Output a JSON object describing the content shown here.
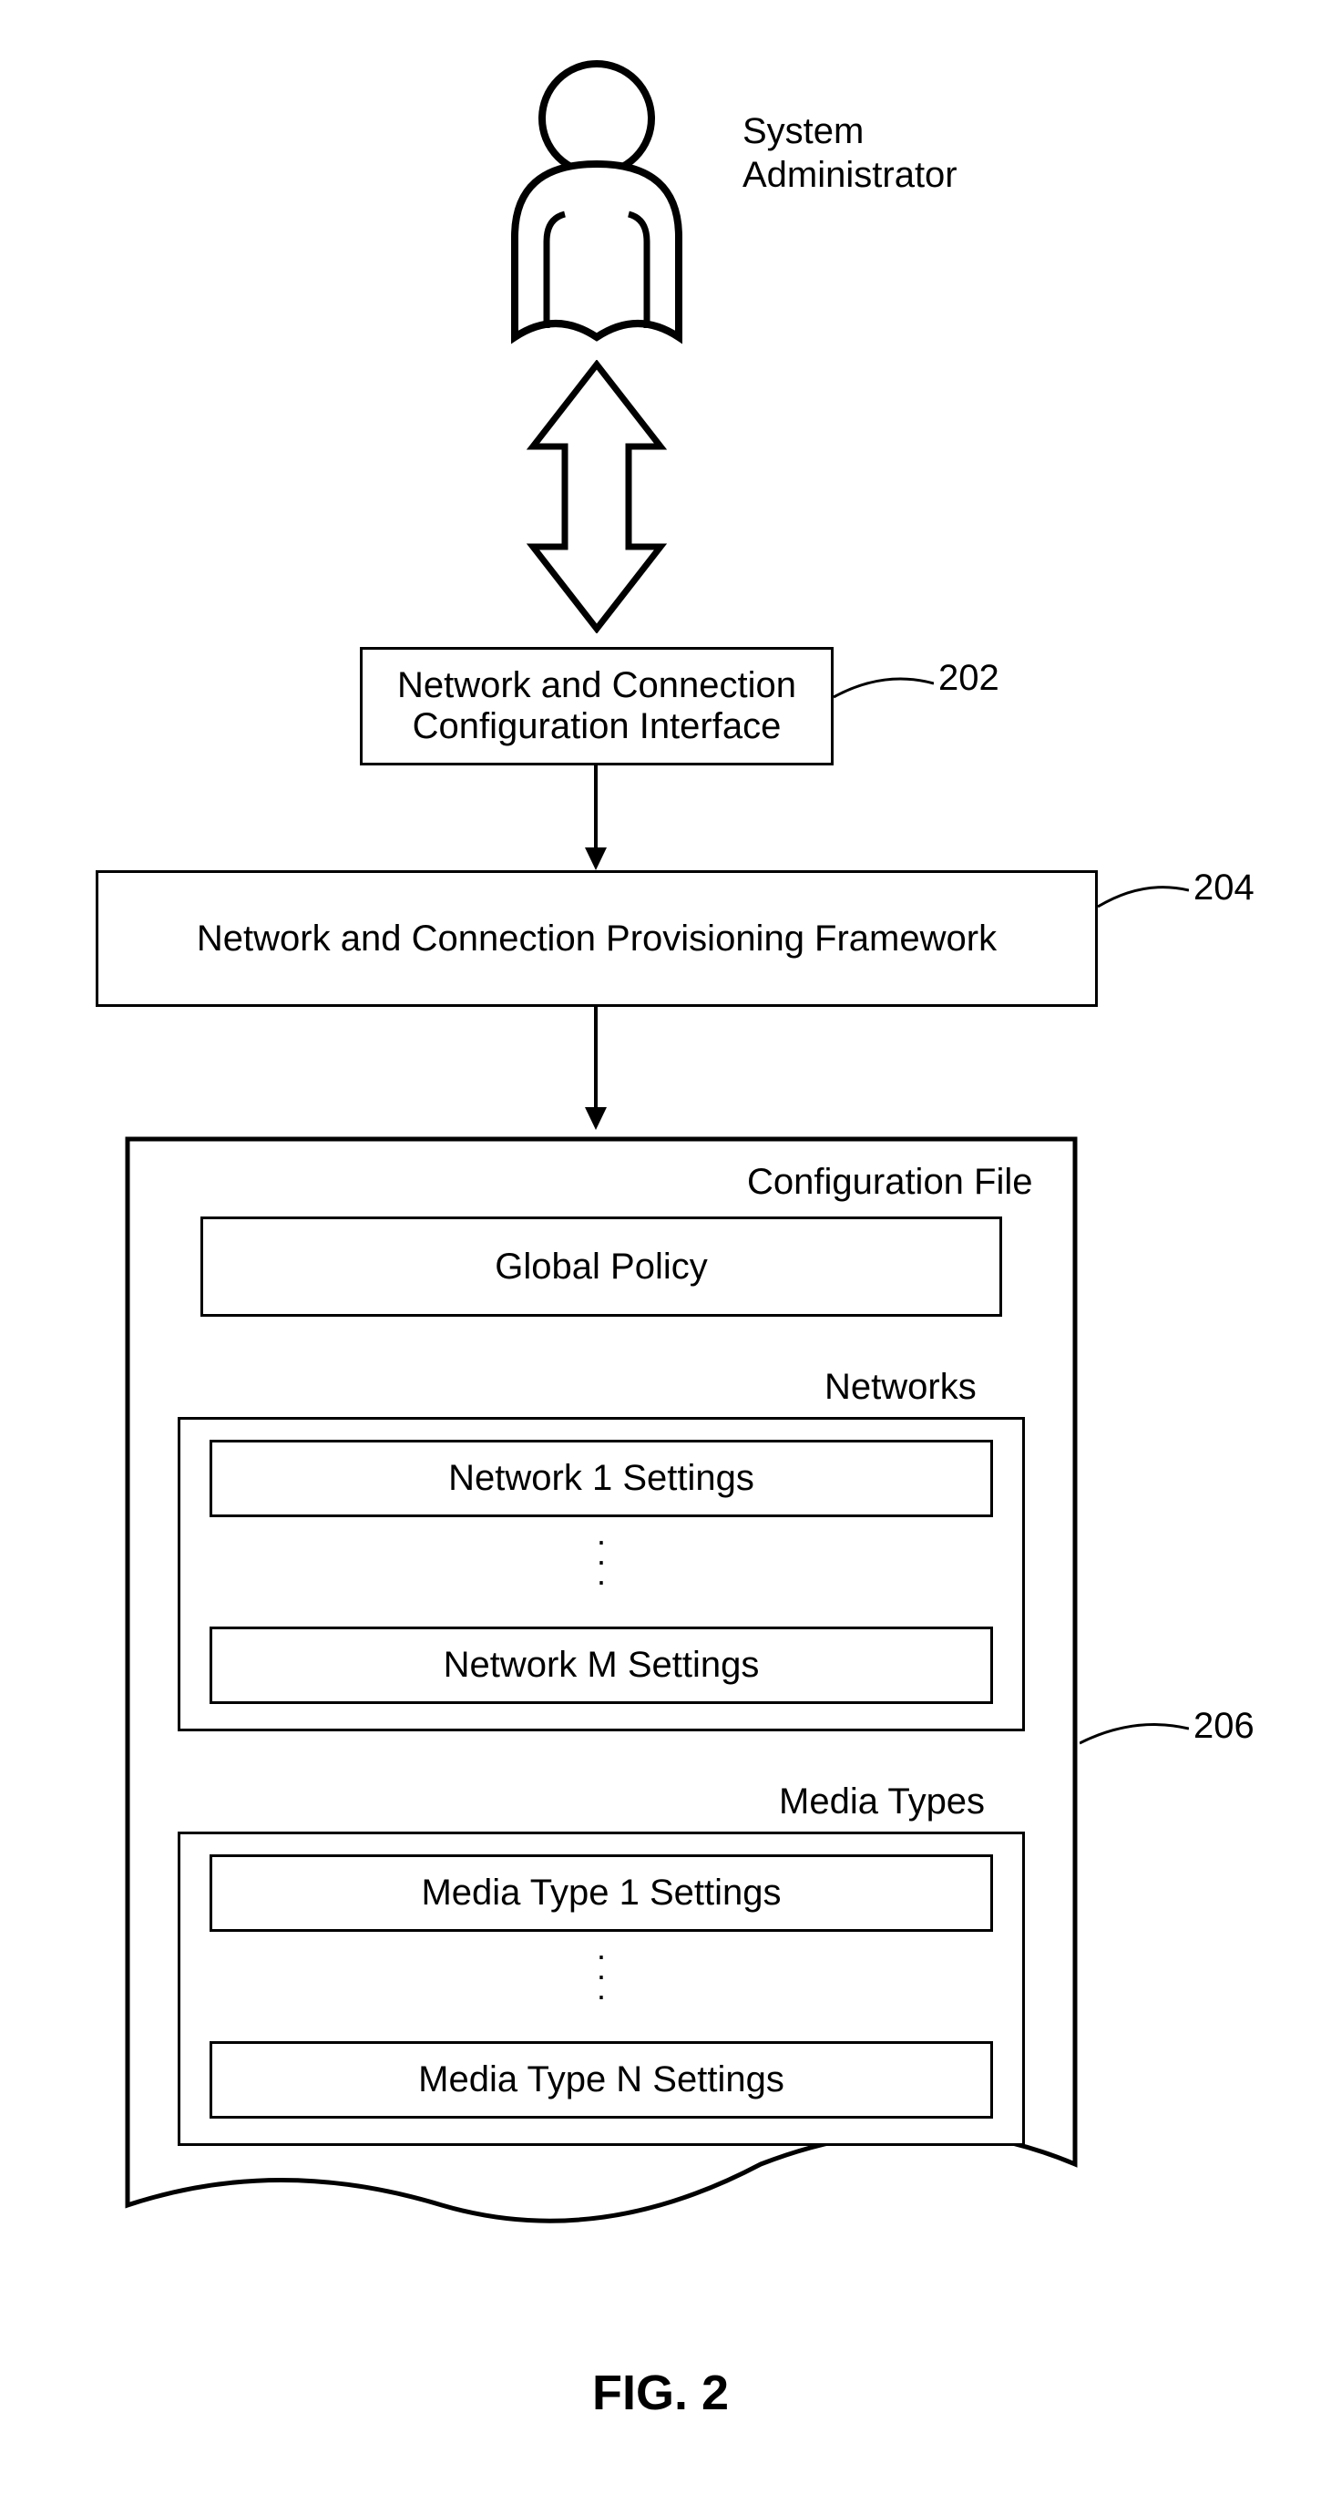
{
  "actor": {
    "label": "System\nAdministrator"
  },
  "refs": {
    "interface": "202",
    "framework": "204",
    "configFile": "206"
  },
  "boxes": {
    "interface": "Network and Connection\nConfiguration Interface",
    "framework": "Network and Connection Provisioning Framework"
  },
  "configFile": {
    "title": "Configuration File",
    "globalPolicy": "Global Policy",
    "networks": {
      "title": "Networks",
      "first": "Network 1 Settings",
      "last": "Network M Settings"
    },
    "mediaTypes": {
      "title": "Media Types",
      "first": "Media Type 1 Settings",
      "last": "Media Type N Settings"
    }
  },
  "figure": "FIG. 2"
}
